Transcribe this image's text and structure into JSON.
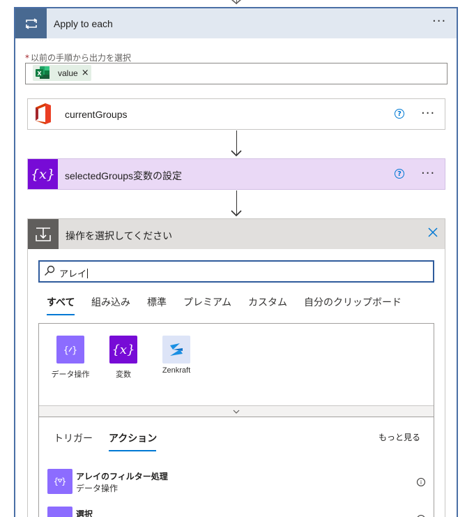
{
  "loop": {
    "title": "Apply to each",
    "more": "···",
    "required_label": "以前の手順から出力を選択",
    "required_star": "*",
    "token": {
      "label": "value",
      "remove": "×"
    }
  },
  "actions": [
    {
      "title": "currentGroups",
      "help": "?",
      "more": "···"
    },
    {
      "title": "selectedGroups変数の設定",
      "help": "?",
      "more": "···",
      "icon_glyph": "{x}"
    }
  ],
  "chooser": {
    "title": "操作を選択してください",
    "search_value": "アレイ",
    "tabs": [
      "すべて",
      "組み込み",
      "標準",
      "プレミアム",
      "カスタム",
      "自分のクリップボード"
    ],
    "active_tab": "すべて",
    "connectors": [
      {
        "label": "データ操作",
        "icon": "data-operation-icon"
      },
      {
        "label": "変数",
        "icon": "variable-icon",
        "glyph": "{x}"
      },
      {
        "label": "Zenkraft",
        "icon": "zenkraft-icon"
      }
    ],
    "subtabs": [
      "トリガー",
      "アクション"
    ],
    "active_subtab": "アクション",
    "see_more": "もっと見る",
    "items": [
      {
        "title": "アレイのフィルター処理",
        "subtitle": "データ操作"
      },
      {
        "title": "選択",
        "subtitle": ""
      }
    ]
  },
  "colors": {
    "loop_header": "#486991",
    "variable_purple": "#770bd6",
    "data_op_purple": "#8c6cff",
    "accent_blue": "#0078d4",
    "variable_card_bg": "#ead9f6"
  }
}
